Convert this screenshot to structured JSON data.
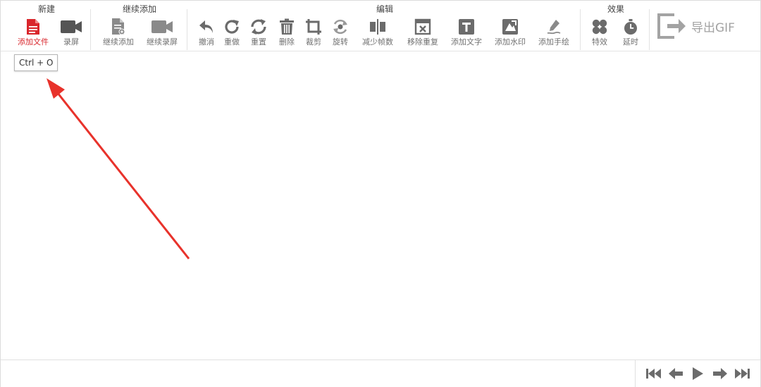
{
  "groups": {
    "new": "新建",
    "continue": "继续添加",
    "edit": "编辑",
    "effects": "效果"
  },
  "tools": {
    "add_file": "添加文件",
    "record": "录屏",
    "continue_add": "继续添加",
    "continue_record": "继续录屏",
    "undo": "撤消",
    "redo": "重做",
    "reset": "重置",
    "delete": "删除",
    "crop": "裁剪",
    "rotate": "旋转",
    "reduce_frames": "减少帧数",
    "remove_duplicates": "移除重复",
    "add_text": "添加文字",
    "add_watermark": "添加水印",
    "add_drawing": "添加手绘",
    "effects": "特效",
    "delay": "延时"
  },
  "export": {
    "label": "导出GIF"
  },
  "tooltip": {
    "text": "Ctrl + O"
  },
  "icons": {
    "add_file": "file-icon",
    "record": "video-camera-icon",
    "continue_add": "file-add-icon",
    "continue_record": "video-camera-icon",
    "undo": "undo-icon",
    "redo": "redo-icon",
    "reset": "refresh-icon",
    "delete": "trash-icon",
    "crop": "crop-icon",
    "rotate": "rotate-icon",
    "reduce_frames": "split-icon",
    "remove_duplicates": "remove-window-icon",
    "add_text": "text-icon",
    "add_watermark": "watermark-icon",
    "add_drawing": "pen-icon",
    "effects": "clover-icon",
    "delay": "stopwatch-icon",
    "export": "export-icon"
  },
  "colors": {
    "accent": "#d9262c",
    "icon": "#6b6b6b",
    "icon_light": "#9a9a9a",
    "arrow": "#e8322b"
  }
}
